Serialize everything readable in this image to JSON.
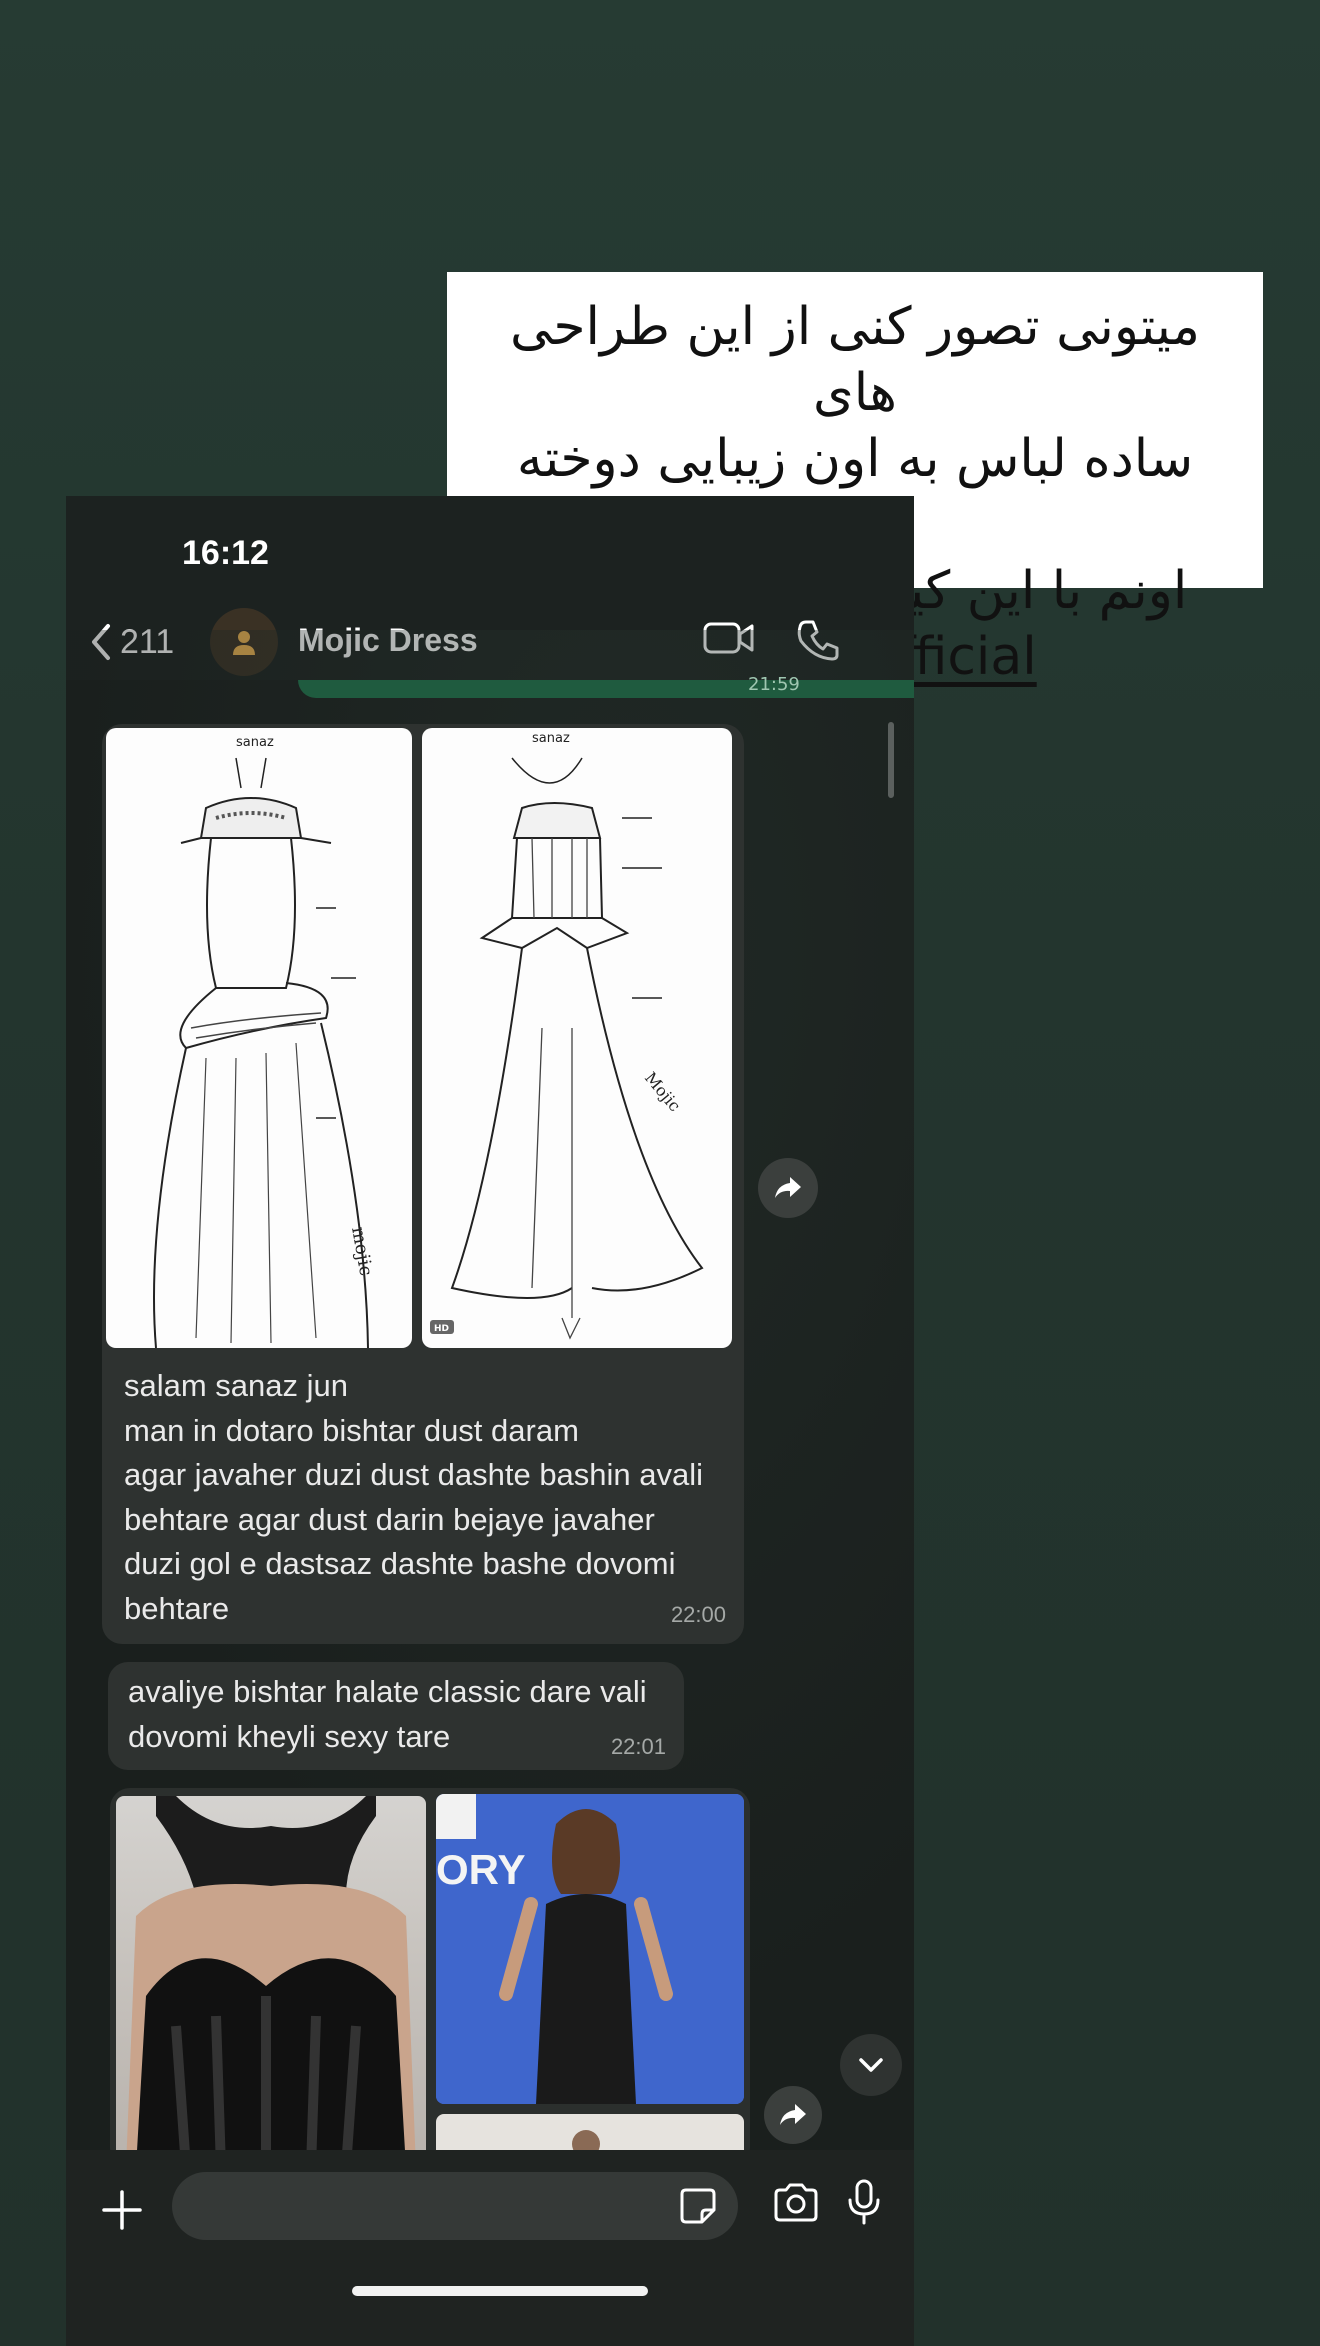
{
  "story": {
    "caption_line1": "میتونی تصور کنی از این طراحی های",
    "caption_line2": "ساده لباس به اون زیبایی دوخته شده",
    "caption_line3": "اونم با این کیفیت دوخت 🥹🙏🏽",
    "mention": "@mojicofficial"
  },
  "status_bar": {
    "time": "16:12"
  },
  "header": {
    "back_count": "211",
    "contact_name": "Mojic Dress",
    "video_icon": "video-camera-icon",
    "call_icon": "phone-icon"
  },
  "messages": {
    "outgoing_time": "21:59",
    "sketch_badge": "HD",
    "sketch_labels": [
      "sanaz",
      "sanaz",
      "mojic",
      "Mojic"
    ],
    "msg1_lines": [
      "salam sanaz jun",
      "man in dotaro bishtar dust daram",
      "agar javaher duzi dust dashte bashin avali",
      "behtare agar dust darin bejaye javaher",
      "duzi gol e dastsaz dashte bashe dovomi",
      "behtare"
    ],
    "msg1_time": "22:00",
    "msg2_lines": [
      "avaliye bishtar halate classic dare vali",
      "dovomi kheyli sexy tare"
    ],
    "msg2_time": "22:01",
    "photo_text": "ORY"
  },
  "input": {
    "placeholder": "",
    "icons": [
      "plus-icon",
      "sticker-icon",
      "camera-icon",
      "microphone-icon"
    ]
  }
}
